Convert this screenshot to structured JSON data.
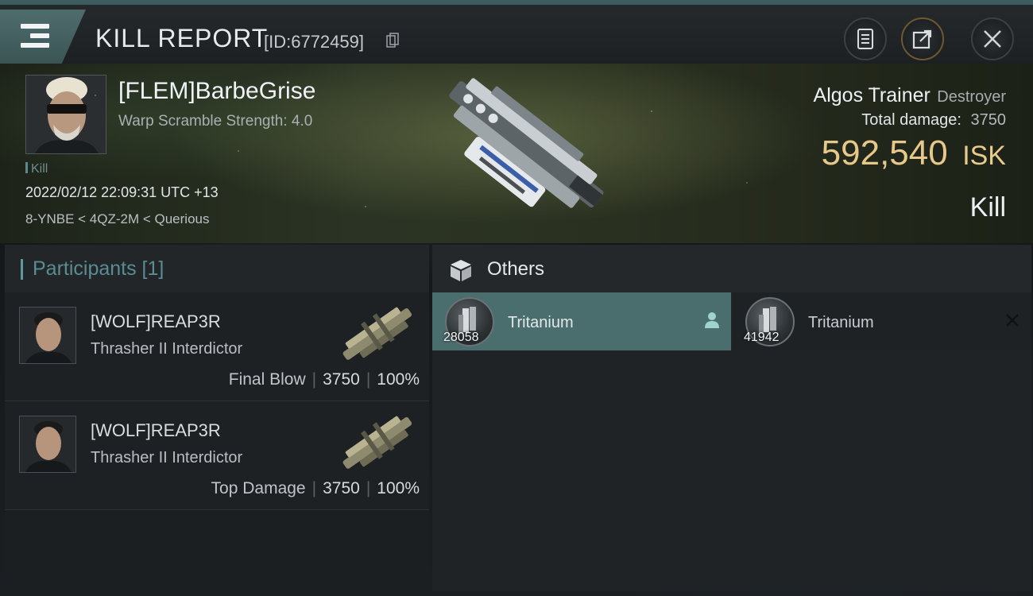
{
  "titlebar": {
    "title": "KILL REPORT",
    "report_id": "[ID:6772459]",
    "icons": [
      "menu-icon",
      "copy-icon",
      "notes-icon",
      "share-icon",
      "close-icon"
    ]
  },
  "victim": {
    "name": "[FLEM]BarbeGrise",
    "subtitle": "Warp Scramble Strength: 4.0",
    "tag": "Kill",
    "datetime": "2022/02/12 22:09:31 UTC +13",
    "location": "8-YNBE < 4QZ-2M < Querious",
    "ship_name": "Algos Trainer",
    "ship_class": "Destroyer",
    "damage_label": "Total damage:",
    "damage_value": "3750",
    "isk_value": "592,540",
    "isk_unit": "ISK",
    "result": "Kill"
  },
  "participants": {
    "title": "Participants [1]",
    "rows": [
      {
        "name": "[WOLF]REAP3R",
        "ship": "Thrasher II Interdictor",
        "role": "Final Blow",
        "damage": "3750",
        "percent": "100%"
      },
      {
        "name": "[WOLF]REAP3R",
        "ship": "Thrasher II Interdictor",
        "role": "Top Damage",
        "damage": "3750",
        "percent": "100%"
      }
    ]
  },
  "others": {
    "title": "Others",
    "items": [
      {
        "name": "Tritanium",
        "qty": "28058",
        "status": "dropped"
      },
      {
        "name": "Tritanium",
        "qty": "41942",
        "status": "destroyed"
      }
    ]
  },
  "colors": {
    "accent": "#4a6d6e",
    "isk_gold": "#e6c98a",
    "participants_title": "#5a8c92"
  }
}
